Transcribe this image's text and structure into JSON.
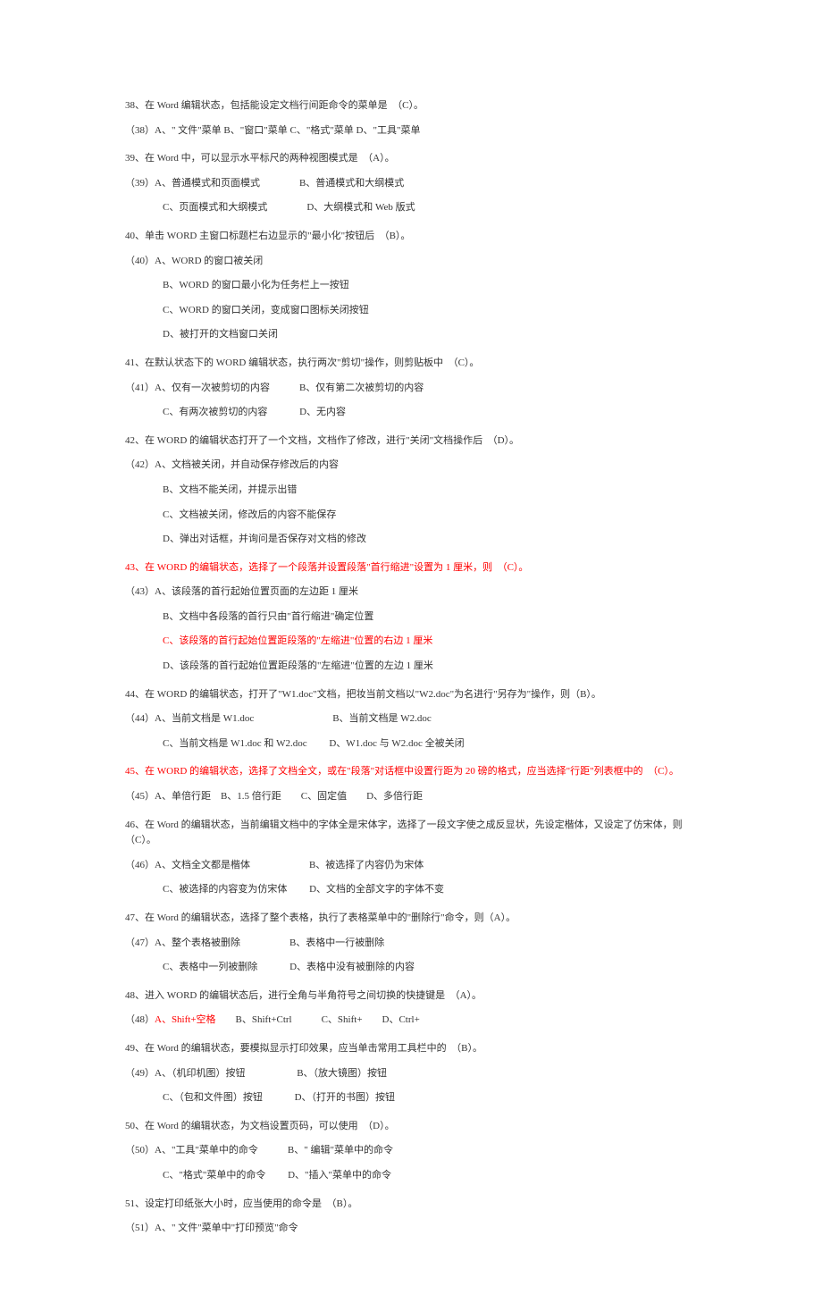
{
  "questions": [
    {
      "id": "38",
      "text": "38、在 Word 编辑状态，包括能设定文档行间距命令的菜单是　（C）。",
      "options": [
        "（38）A、\" 文件\"菜单 B、\"窗口\"菜单 C、\"格式\"菜单 D、\"工具\"菜单"
      ],
      "red": false
    },
    {
      "id": "39",
      "text": "39、在 Word 中，可以显示水平标尺的两种视图模式是　（A）。",
      "options": [
        "（39）A、普通模式和页面模式　　　　B、普通模式和大纲模式",
        "C、页面模式和大纲模式　　　　D、大纲模式和 Web 版式"
      ],
      "red": false
    },
    {
      "id": "40",
      "text": "40、单击 WORD 主窗口标题栏右边显示的\"最小化\"按钮后　（B）。",
      "options": [
        "（40）A、WORD 的窗口被关闭",
        "B、WORD 的窗口最小化为任务栏上一按钮",
        "C、WORD 的窗口关闭，变成窗口图标关闭按钮",
        "D、被打开的文档窗口关闭"
      ],
      "red": false
    },
    {
      "id": "41",
      "text": "41、在默认状态下的 WORD 编辑状态，执行两次\"剪切\"操作，则剪贴板中　（C）。",
      "options": [
        "（41）A、仅有一次被剪切的内容　　　B、仅有第二次被剪切的内容",
        "C、有两次被剪切的内容　　　 D、无内容"
      ],
      "red": false
    },
    {
      "id": "42",
      "text": "42、在 WORD 的编辑状态打开了一个文档，文档作了修改，进行\"关闭\"文档操作后　（D）。",
      "options": [
        "（42）A、文档被关闭，并自动保存修改后的内容",
        "B、文档不能关闭，并提示出错",
        "C、文档被关闭，修改后的内容不能保存",
        "D、弹出对话框，并询问是否保存对文档的修改"
      ],
      "red": false
    },
    {
      "id": "43",
      "text": "43、在 WORD 的编辑状态，选择了一个段落并设置段落\"首行缩进\"设置为 1 厘米，则　（C）。",
      "options": [
        "（43）A、该段落的首行起始位置页面的左边距 1 厘米",
        "B、文档中各段落的首行只由\"首行缩进\"确定位置",
        "C、该段落的首行起始位置距段落的\"左缩进\"位置的右边 1 厘米",
        "D、该段落的首行起始位置距段落的\"左缩进\"位置的左边 1 厘米"
      ],
      "red": true,
      "redOptionIndex": 2
    },
    {
      "id": "44",
      "text": "44、在 WORD 的编辑状态，打开了\"W1.doc\"文档，把妆当前文档以\"W2.doc\"为名进行\"另存为\"操作，则（B）。",
      "options": [
        "（44）A、当前文档是 W1.doc　　　　　　　　B、当前文档是 W2.doc",
        "C、当前文档是 W1.doc 和 W2.doc　　 D、W1.doc 与 W2.doc 全被关闭"
      ],
      "red": false
    },
    {
      "id": "45",
      "text": "45、在 WORD 的编辑状态，选择了文档全文，或在\"段落\"对话框中设置行距为 20 磅的格式，应当选择\"行距\"列表框中的　（C）。",
      "options": [
        "（45）A、单倍行距　B、1.5 倍行距　　C、固定值　　D、多倍行距"
      ],
      "red": true
    },
    {
      "id": "46",
      "text": "46、在 Word 的编辑状态，当前编辑文档中的字体全是宋体字，选择了一段文字使之成反显状，先设定楷体，又设定了仿宋体，则　（C）。",
      "options": [
        "（46）A、文档全文都是楷体　　　　　　B、被选择了内容仍为宋体",
        "C、被选择的内容变为仿宋体　　 D、文档的全部文字的字体不变"
      ],
      "red": false
    },
    {
      "id": "47",
      "text": "47、在 Word 的编辑状态，选择了整个表格，执行了表格菜单中的\"删除行\"命令，则（A）。",
      "options": [
        "（47）A、整个表格被删除　　　　　B、表格中一行被删除",
        "C、表格中一列被删除　　　 D、表格中没有被删除的内容"
      ],
      "red": false
    },
    {
      "id": "48",
      "text": "48、进入 WORD 的编辑状态后，进行全角与半角符号之间切换的快捷键是　（A）。",
      "options": [
        "（48）A、Shift+空格　　B、Shift+Ctrl　　　C、Shift+　　D、Ctrl+"
      ],
      "red": false,
      "redPartial": "A、Shift+空格"
    },
    {
      "id": "49",
      "text": "49、在 Word 的编辑状态，要模拟显示打印效果，应当单击常用工具栏中的　（B）。",
      "options": [
        "（49）A、（机印机图）按钮　　　　　 B、（放大镜图）按钮",
        "C、（包和文件图）按钮　　　 D、（打开的书图）按钮"
      ],
      "red": false
    },
    {
      "id": "50",
      "text": "50、在 Word 的编辑状态，为文档设置页码，可以使用　（D）。",
      "options": [
        "（50）A、\"工具\"菜单中的命令　　　B、\" 编辑\"菜单中的命令",
        "C、\"格式\"菜单中的命令　　 D、\"插入\"菜单中的命令"
      ],
      "red": false
    },
    {
      "id": "51",
      "text": "51、设定打印纸张大小时，应当使用的命令是　（B）。",
      "options": [
        "（51）A、\" 文件\"菜单中\"打印预览\"命令"
      ],
      "red": false
    }
  ]
}
